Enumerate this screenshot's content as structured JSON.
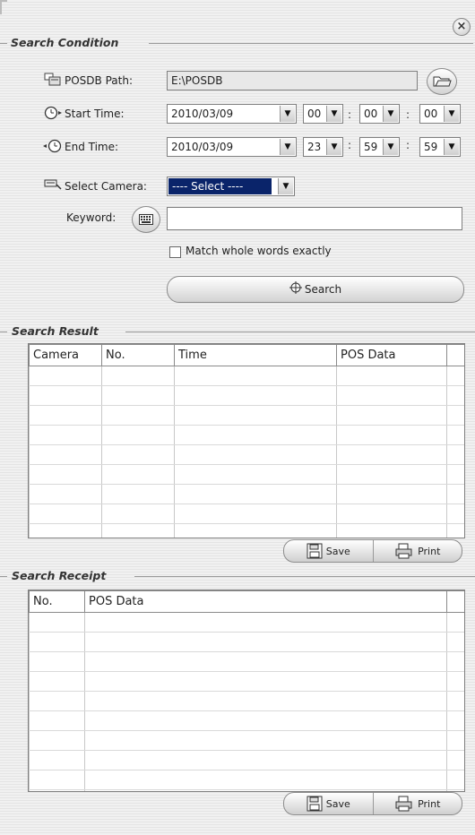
{
  "window": {
    "close_symbol": "×"
  },
  "search_condition": {
    "title": "Search Condition",
    "posdb_path": {
      "label": "POSDB Path:",
      "value": "E:\\POSDB"
    },
    "start_time": {
      "label": "Start Time:",
      "date": "2010/03/09",
      "hour": "00",
      "minute": "00",
      "second": "00"
    },
    "end_time": {
      "label": "End Time:",
      "date": "2010/03/09",
      "hour": "23",
      "minute": "59",
      "second": "59"
    },
    "select_camera": {
      "label": "Select Camera:",
      "value": "---- Select ----"
    },
    "keyword": {
      "label": "Keyword:",
      "value": ""
    },
    "match_whole_words": {
      "label": "Match whole words exactly",
      "checked": false
    },
    "search_button": "Search",
    "time_separator": ":"
  },
  "search_result": {
    "title": "Search Result",
    "columns": [
      "Camera",
      "No.",
      "Time",
      "POS Data"
    ],
    "save_label": "Save",
    "print_label": "Print"
  },
  "search_receipt": {
    "title": "Search Receipt",
    "columns": [
      "No.",
      "POS Data"
    ],
    "save_label": "Save",
    "print_label": "Print"
  },
  "icons": {
    "close": "close-icon",
    "folder": "folder-icon",
    "posdb": "database-icon",
    "start": "clock-start-icon",
    "end": "clock-end-icon",
    "camera": "camera-icon",
    "keyboard": "keyboard-icon",
    "search": "crosshair-icon",
    "save": "floppy-icon",
    "print": "printer-icon"
  }
}
